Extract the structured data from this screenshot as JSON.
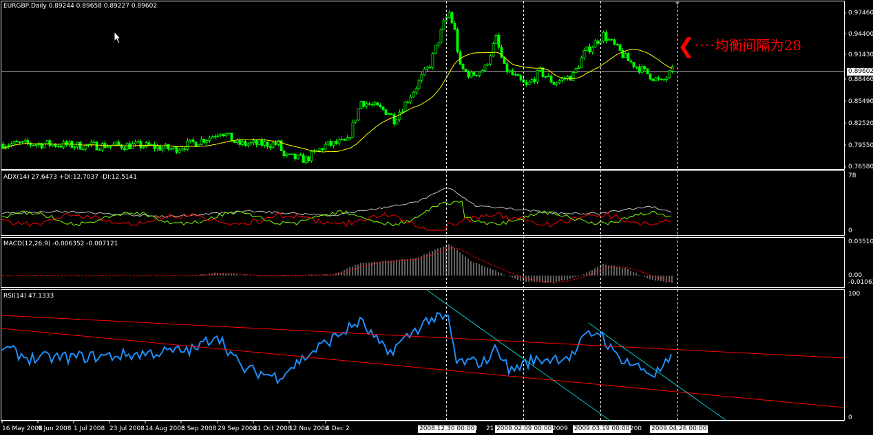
{
  "main": {
    "symbol_info": "EURGBP,Daily  0.89244 0.89658 0.89227 0.89602",
    "current_price": "0.89602",
    "price_axis": [
      "0.97460",
      "0.94400",
      "0.91430",
      "0.88460",
      "0.85490",
      "0.82520",
      "0.79550",
      "0.76580"
    ],
    "annotation": "均衡间隔为28",
    "annotation_dots": "····"
  },
  "adx": {
    "label": "ADX(14) 27.6473  +DI:12.7037 -DI:12.5141",
    "axis": [
      "78",
      "0"
    ]
  },
  "macd": {
    "label": "MACD(12,26,9) -0.006352 -0.007121",
    "axis": [
      "0.035106",
      "0.00",
      "-0.01062"
    ]
  },
  "rsi": {
    "label": "RSI(14) 47.1333",
    "axis": [
      "100",
      "0"
    ]
  },
  "time_axis": [
    "16 May 2008",
    "9 Jun 2008",
    "1 Jul 2008",
    "23 Jul 2008",
    "14 Aug 2008",
    "5 Sep 2008",
    "29 Sep 2008",
    "21 Oct 2008",
    "12 Nov 2008",
    "4 Dec 2",
    "8",
    "21",
    "2009",
    "Mar 200"
  ],
  "cursor_labels": [
    "2008.12.30 00:00",
    "2009.02.09 00:00",
    "2009.03.19 00:00",
    "2009.04.26 00:00"
  ],
  "colors": {
    "candle": "#00ff00",
    "ma": "#ffff00",
    "plus_di": "#7fff00",
    "minus_di": "#ff0000",
    "adx": "#c0c0c0",
    "rsi": "#1e90ff",
    "trend_red": "#ff0000",
    "trend_cyan": "#00ced1"
  },
  "chart_data": {
    "type": "line",
    "price_keypoints": [
      [
        0,
        0.797
      ],
      [
        14,
        0.797
      ],
      [
        27,
        0.795
      ],
      [
        50,
        0.795
      ],
      [
        62,
        0.79
      ],
      [
        75,
        0.806
      ],
      [
        79,
        0.815
      ],
      [
        85,
        0.797
      ],
      [
        100,
        0.797
      ],
      [
        102,
        0.78
      ],
      [
        110,
        0.776
      ],
      [
        117,
        0.795
      ],
      [
        125,
        0.8
      ],
      [
        130,
        0.855
      ],
      [
        140,
        0.84
      ],
      [
        142,
        0.83
      ],
      [
        150,
        0.875
      ],
      [
        155,
        0.905
      ],
      [
        160,
        0.96
      ],
      [
        162,
        0.975
      ],
      [
        164,
        0.95
      ],
      [
        166,
        0.9
      ],
      [
        170,
        0.89
      ],
      [
        175,
        0.9
      ],
      [
        179,
        0.94
      ],
      [
        182,
        0.9
      ],
      [
        190,
        0.875
      ],
      [
        195,
        0.895
      ],
      [
        200,
        0.88
      ],
      [
        207,
        0.89
      ],
      [
        211,
        0.92
      ],
      [
        218,
        0.945
      ],
      [
        222,
        0.93
      ],
      [
        227,
        0.91
      ],
      [
        235,
        0.89
      ],
      [
        239,
        0.88
      ],
      [
        243,
        0.896
      ]
    ],
    "rsi_keypoints": [
      [
        0,
        57
      ],
      [
        10,
        48
      ],
      [
        40,
        50
      ],
      [
        70,
        55
      ],
      [
        78,
        68
      ],
      [
        87,
        40
      ],
      [
        100,
        33
      ],
      [
        115,
        57
      ],
      [
        130,
        78
      ],
      [
        140,
        52
      ],
      [
        155,
        80
      ],
      [
        162,
        80
      ],
      [
        165,
        45
      ],
      [
        175,
        45
      ],
      [
        180,
        57
      ],
      [
        184,
        38
      ],
      [
        192,
        46
      ],
      [
        207,
        50
      ],
      [
        212,
        66
      ],
      [
        217,
        70
      ],
      [
        222,
        52
      ],
      [
        230,
        42
      ],
      [
        237,
        35
      ],
      [
        243,
        47
      ]
    ],
    "macd_keypoints": [
      [
        0,
        0.0
      ],
      [
        70,
        0.0
      ],
      [
        78,
        0.003
      ],
      [
        90,
        0.0
      ],
      [
        120,
        0.001
      ],
      [
        130,
        0.013
      ],
      [
        150,
        0.018
      ],
      [
        162,
        0.033
      ],
      [
        170,
        0.015
      ],
      [
        180,
        0.004
      ],
      [
        188,
        -0.006
      ],
      [
        200,
        -0.008
      ],
      [
        210,
        0.0
      ],
      [
        218,
        0.012
      ],
      [
        226,
        0.008
      ],
      [
        235,
        -0.004
      ],
      [
        243,
        -0.008
      ]
    ],
    "adx_keypoints": [
      [
        0,
        25
      ],
      [
        20,
        28
      ],
      [
        60,
        20
      ],
      [
        90,
        28
      ],
      [
        120,
        22
      ],
      [
        150,
        40
      ],
      [
        162,
        62
      ],
      [
        172,
        35
      ],
      [
        190,
        30
      ],
      [
        200,
        25
      ],
      [
        218,
        25
      ],
      [
        235,
        35
      ],
      [
        243,
        27.6
      ]
    ],
    "ylim_price": [
      0.7658,
      0.9746
    ],
    "ylim_adx": [
      0,
      78
    ],
    "ylim_macd": [
      -0.01062,
      0.035106
    ],
    "ylim_rsi": [
      0,
      100
    ]
  }
}
